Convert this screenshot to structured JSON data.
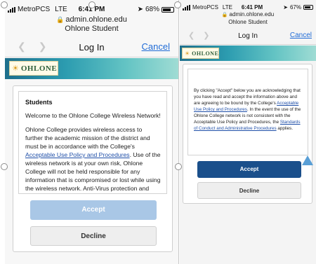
{
  "left_screen": {
    "status_bar": {
      "carrier": "MetroPCS",
      "network": "LTE",
      "time": "6:41 PM",
      "battery": "68%",
      "battery_level": 0.68
    },
    "url": {
      "domain": "admin.ohlone.edu",
      "page_title": "Ohlone Student"
    },
    "nav": {
      "back_icon": "chevron-left-icon",
      "forward_icon": "chevron-right-icon",
      "title": "Log In",
      "cancel_label": "Cancel"
    },
    "logo": {
      "text": "OHLONE"
    },
    "content": {
      "heading": "Students",
      "welcome": "Welcome to the Ohlone College Wireless Network!",
      "body_start": "Ohlone College provides wireless access to further the academic mission of the district and must be in accordance with the College's ",
      "policy_link": "Acceptable Use Policy and Procedures",
      "body_end": ". Use of the wireless network is at your own risk, Ohlone College will not be held responsible for any information that is compromised or lost while using the wireless network. Anti-Virus protection and operating system security patching is"
    },
    "buttons": {
      "accept": "Accept",
      "decline": "Decline"
    }
  },
  "right_screen": {
    "status_bar": {
      "carrier": "MetroPCS",
      "network": "LTE",
      "time": "6:41 PM",
      "battery": "67%",
      "battery_level": 0.67
    },
    "url": {
      "domain": "admin.ohlone.edu",
      "page_title": "Ohlone Student"
    },
    "nav": {
      "back_icon": "chevron-left-icon",
      "forward_icon": "chevron-right-icon",
      "title": "Log In",
      "cancel_label": "Cancel"
    },
    "logo": {
      "text": "OHLONE"
    },
    "content": {
      "p1": "By clicking \"Accept\" below you are acknowledging that you have read and accept the information above and are agreeing to be bound by the College's ",
      "policy_link": "Acceptable Use Policy and Procedures",
      "p2": ". In the event the use of the Ohlone College network is not consistent with the Acceptable Use Policy and Procedures, the ",
      "conduct_link": "Standards of Conduct and Administrative Procedures",
      "p3": " applies."
    },
    "buttons": {
      "accept": "Accept",
      "decline": "Decline"
    },
    "colors": {
      "accept_bg": "#1a4f8b"
    }
  },
  "colors": {
    "link": "#1f6bd6",
    "accept_disabled": "#a9c7e6"
  }
}
